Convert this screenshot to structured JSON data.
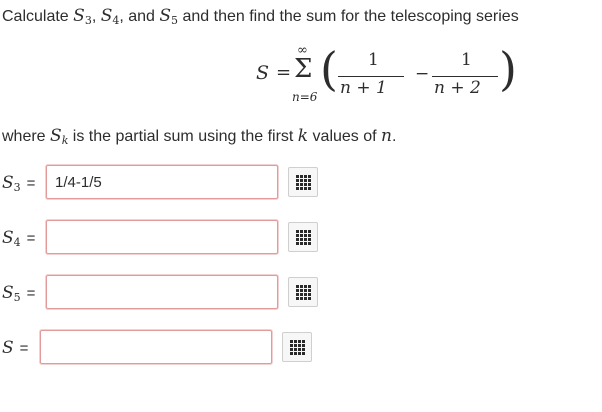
{
  "question": {
    "prefix": "Calculate ",
    "s3": "S",
    "s3_sub": "3",
    "comma1": ", ",
    "s4": "S",
    "s4_sub": "4",
    "comma2": ", and ",
    "s5": "S",
    "s5_sub": "5",
    "suffix": " and then find the sum for the telescoping series"
  },
  "formula": {
    "lhs": "S",
    "equals": "=",
    "sigma": "Σ",
    "upper_limit": "∞",
    "lower_limit": "n=6",
    "term1_numerator": "1",
    "term1_denominator": "n + 1",
    "minus": "−",
    "term2_numerator": "1",
    "term2_denominator": "n + 2",
    "open_paren": "(",
    "close_paren": ")"
  },
  "where": {
    "prefix": "where ",
    "sk": "S",
    "sk_sub": "k",
    "middle": " is the partial sum using the first ",
    "k": "k",
    "middle2": " values of ",
    "n": "n",
    "suffix": "."
  },
  "answers": [
    {
      "label": "S",
      "sub": "3",
      "equals": "=",
      "value": "1/4-1/5",
      "placeholder": ""
    },
    {
      "label": "S",
      "sub": "4",
      "equals": "=",
      "value": "",
      "placeholder": ""
    },
    {
      "label": "S",
      "sub": "5",
      "equals": "=",
      "value": "",
      "placeholder": ""
    },
    {
      "label": "S",
      "sub": "",
      "equals": "=",
      "value": "",
      "placeholder": ""
    }
  ],
  "keypad_icon": "keypad-grid-icon",
  "colors": {
    "input_border": "#e29a9a",
    "text": "#2d2d2d",
    "keypad_icon": "#2a2a2a"
  }
}
